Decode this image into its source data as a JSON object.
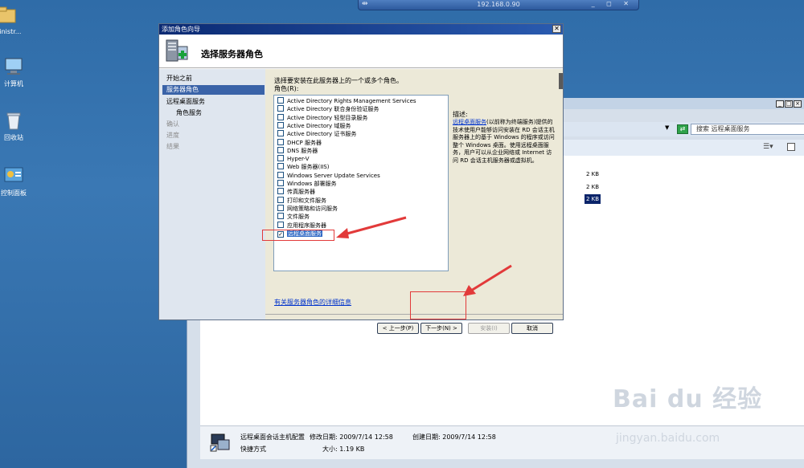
{
  "rdp": {
    "ip": "192.168.0.90",
    "pin": "⇹",
    "controls": "_ ◻ ✕"
  },
  "desktop": {
    "icons": [
      {
        "label": "ministr..."
      },
      {
        "label": "计算机"
      },
      {
        "label": "回收站"
      },
      {
        "label": "控制面板"
      }
    ]
  },
  "explorer": {
    "search_placeholder": "搜索 远程桌面服务",
    "sizes": [
      "2 KB",
      "2 KB",
      "2 KB"
    ],
    "status": {
      "name": "远程桌面会话主机配置",
      "modified": "修改日期: 2009/7/14 12:58",
      "created": "创建日期: 2009/7/14 12:58",
      "type": "快捷方式",
      "size": "大小: 1.19 KB"
    }
  },
  "wizard": {
    "title": "添加角色向导",
    "close": "✕",
    "header_title": "选择服务器角色",
    "nav": [
      {
        "label": "开始之前"
      },
      {
        "label": "服务器角色"
      },
      {
        "label": "远程桌面服务"
      },
      {
        "label": "角色服务"
      },
      {
        "label": "确认"
      },
      {
        "label": "进度"
      },
      {
        "label": "结果"
      }
    ],
    "instruction": "选择要安装在此服务器上的一个或多个角色。",
    "roles_label": "角色(R):",
    "roles": [
      {
        "label": "Active Directory Rights Management Services",
        "checked": false
      },
      {
        "label": "Active Directory 联合身份验证服务",
        "checked": false
      },
      {
        "label": "Active Directory 轻型目录服务",
        "checked": false
      },
      {
        "label": "Active Directory 域服务",
        "checked": false
      },
      {
        "label": "Active Directory 证书服务",
        "checked": false
      },
      {
        "label": "DHCP 服务器",
        "checked": false
      },
      {
        "label": "DNS 服务器",
        "checked": false
      },
      {
        "label": "Hyper-V",
        "checked": false
      },
      {
        "label": "Web 服务器(IIS)",
        "checked": false
      },
      {
        "label": "Windows Server Update Services",
        "checked": false
      },
      {
        "label": "Windows 部署服务",
        "checked": false
      },
      {
        "label": "传真服务器",
        "checked": false
      },
      {
        "label": "打印和文件服务",
        "checked": false
      },
      {
        "label": "网络策略和访问服务",
        "checked": false
      },
      {
        "label": "文件服务",
        "checked": false
      },
      {
        "label": "应用程序服务器",
        "checked": false
      },
      {
        "label": "远程桌面服务",
        "checked": true
      }
    ],
    "check_mark": "✓",
    "description": {
      "label": "描述:",
      "link": "远程桌面服务",
      "text": "(以前称为终端服务)提供的技术使用户能够访问安装在 RD 会话主机服务器上的基于 Windows 的程序或访问整个 Windows 桌面。使用远程桌面服务，用户可以从企业网络或 Internet 访问 RD 会话主机服务器或虚拟机。"
    },
    "more_info": "有关服务器角色的详细信息",
    "buttons": {
      "back": "< 上一步(P)",
      "next": "下一步(N) >",
      "install": "安装(I)",
      "cancel": "取消"
    }
  },
  "watermark": {
    "brand": "Bai du 经验",
    "url": "jingyan.baidu.com"
  },
  "colors": {
    "accent": "#3a63a8",
    "annotation": "#e23a3a",
    "link": "#0033cc"
  }
}
